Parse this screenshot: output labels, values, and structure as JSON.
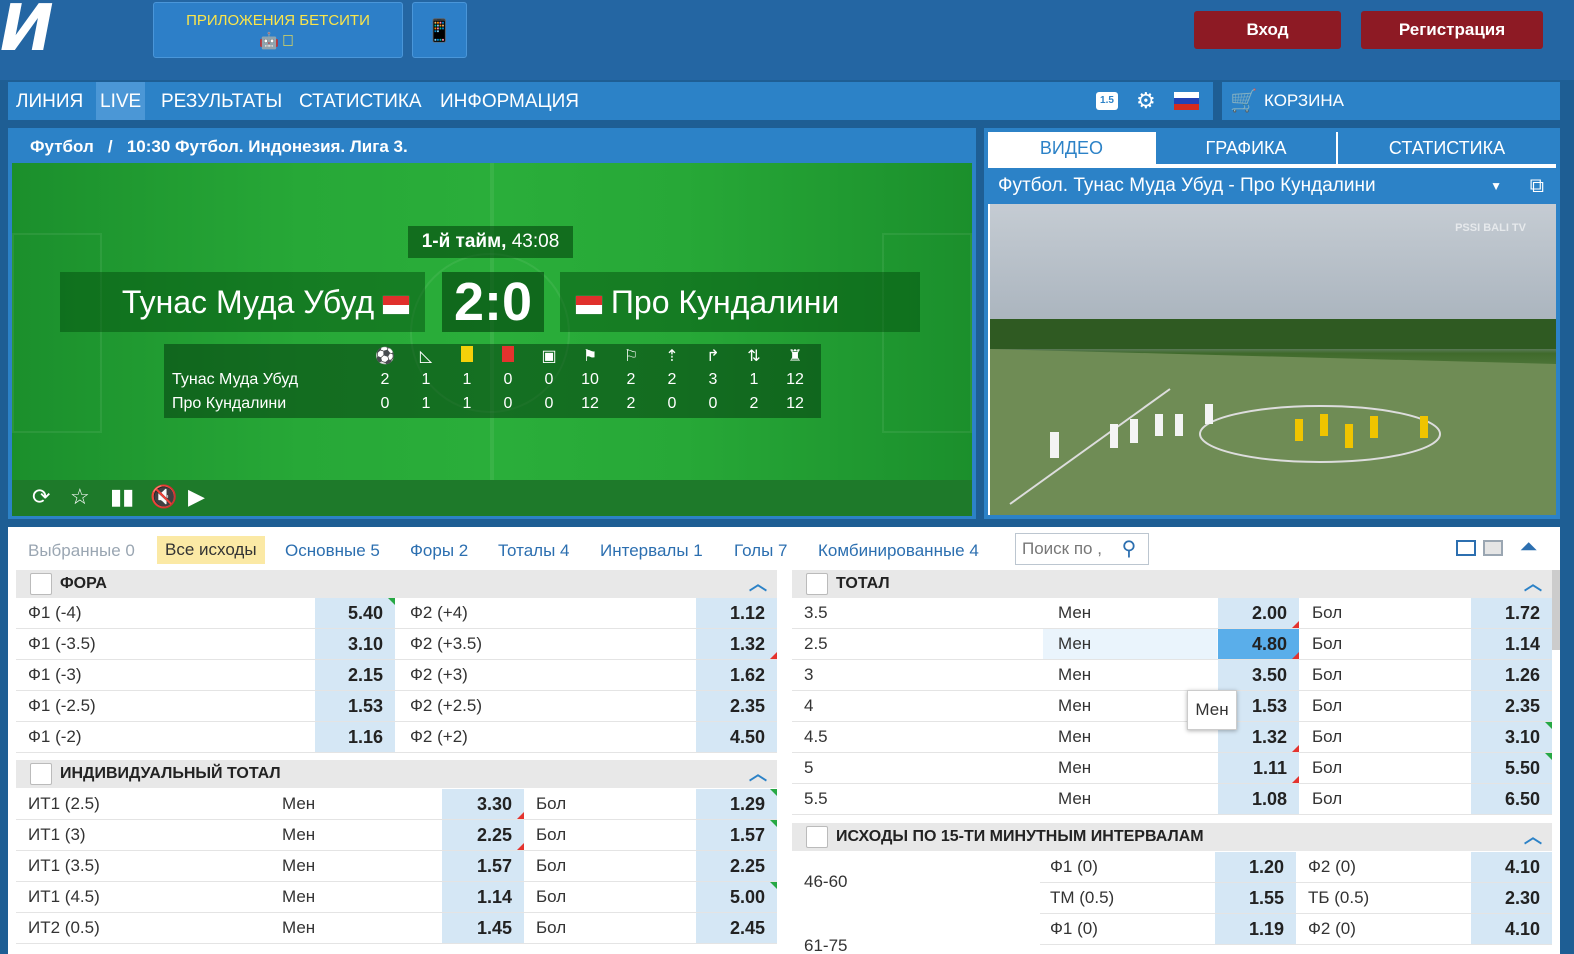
{
  "header": {
    "apps_label": "ПРИЛОЖЕНИЯ БЕТСИТИ",
    "apps_icons": "☗ ",
    "login": "Вход",
    "register": "Регистрация"
  },
  "nav": {
    "items": [
      "ЛИНИЯ",
      "LIVE",
      "РЕЗУЛЬТАТЫ",
      "СТАТИСТИКА",
      "ИНФОРМАЦИЯ"
    ],
    "odds_format": "1.5",
    "cart": "КОРЗИНА"
  },
  "event": {
    "breadcrumb": "Футбол   /   10:30 Футбол. Индонезия. Лига 3.",
    "period_label": "1-й тайм,",
    "period_time": "43:08",
    "home": "Тунас Муда Убуд",
    "away": "Про Кундалини",
    "score": "2:0",
    "stats": {
      "home": [
        "2",
        "1",
        "1",
        "0",
        "0",
        "10",
        "2",
        "2",
        "3",
        "1",
        "12"
      ],
      "away": [
        "0",
        "1",
        "1",
        "0",
        "0",
        "12",
        "2",
        "0",
        "0",
        "2",
        "12"
      ]
    }
  },
  "video": {
    "tabs": [
      "ВИДЕО",
      "ГРАФИКА",
      "СТАТИСТИКА"
    ],
    "title": "Футбол. Тунас Муда Убуд - Про Кундалини",
    "watermark": "PSSI BALI TV"
  },
  "filters": {
    "selected": "Выбранные 0",
    "all": "Все исходы",
    "main": "Основные 5",
    "handicap": "Форы 2",
    "totals": "Тоталы 4",
    "intervals": "Интервалы 1",
    "goals": "Голы 7",
    "combined": "Комбинированные 4",
    "search_placeholder": "Поиск по ,"
  },
  "fora": {
    "title": "ФОРА",
    "rows": [
      {
        "a": "Ф1 (-4)",
        "ao": "5.40",
        "b": "Ф2 (+4)",
        "bo": "1.12"
      },
      {
        "a": "Ф1 (-3.5)",
        "ao": "3.10",
        "b": "Ф2 (+3.5)",
        "bo": "1.32"
      },
      {
        "a": "Ф1 (-3)",
        "ao": "2.15",
        "b": "Ф2 (+3)",
        "bo": "1.62"
      },
      {
        "a": "Ф1 (-2.5)",
        "ao": "1.53",
        "b": "Ф2 (+2.5)",
        "bo": "2.35"
      },
      {
        "a": "Ф1 (-2)",
        "ao": "1.16",
        "b": "Ф2 (+2)",
        "bo": "4.50"
      }
    ]
  },
  "indtotal": {
    "title": "ИНДИВИДУАЛЬНЫЙ ТОТАЛ",
    "rows": [
      {
        "n": "ИТ1 (2.5)",
        "u": "Мен",
        "uo": "3.30",
        "o": "Бол",
        "oo": "1.29"
      },
      {
        "n": "ИТ1 (3)",
        "u": "Мен",
        "uo": "2.25",
        "o": "Бол",
        "oo": "1.57"
      },
      {
        "n": "ИТ1 (3.5)",
        "u": "Мен",
        "uo": "1.57",
        "o": "Бол",
        "oo": "2.25"
      },
      {
        "n": "ИТ1 (4.5)",
        "u": "Мен",
        "uo": "1.14",
        "o": "Бол",
        "oo": "5.00"
      },
      {
        "n": "ИТ2 (0.5)",
        "u": "Мен",
        "uo": "1.45",
        "o": "Бол",
        "oo": "2.45"
      }
    ]
  },
  "total": {
    "title": "ТОТАЛ",
    "rows": [
      {
        "n": "3.5",
        "u": "Мен",
        "uo": "2.00",
        "o": "Бол",
        "oo": "1.72"
      },
      {
        "n": "2.5",
        "u": "Мен",
        "uo": "4.80",
        "o": "Бол",
        "oo": "1.14"
      },
      {
        "n": "3",
        "u": "Мен",
        "uo": "3.50",
        "o": "Бол",
        "oo": "1.26"
      },
      {
        "n": "4",
        "u": "Мен",
        "uo": "1.53",
        "o": "Бол",
        "oo": "2.35"
      },
      {
        "n": "4.5",
        "u": "Мен",
        "uo": "1.32",
        "o": "Бол",
        "oo": "3.10"
      },
      {
        "n": "5",
        "u": "Мен",
        "uo": "1.11",
        "o": "Бол",
        "oo": "5.50"
      },
      {
        "n": "5.5",
        "u": "Мен",
        "uo": "1.08",
        "o": "Бол",
        "oo": "6.50"
      }
    ],
    "tooltip": "Мен"
  },
  "intervals": {
    "title": "ИСХОДЫ ПО 15-ТИ МИНУТНЫМ ИНТЕРВАЛАМ",
    "period": "46-60",
    "next_period": "61-75",
    "rows": [
      {
        "a": "Ф1 (0)",
        "ao": "1.20",
        "b": "Ф2 (0)",
        "bo": "4.10"
      },
      {
        "a": "ТМ (0.5)",
        "ao": "1.55",
        "b": "ТБ (0.5)",
        "bo": "2.30"
      },
      {
        "a": "Ф1 (0)",
        "ao": "1.19",
        "b": "Ф2 (0)",
        "bo": "4.10"
      }
    ]
  }
}
